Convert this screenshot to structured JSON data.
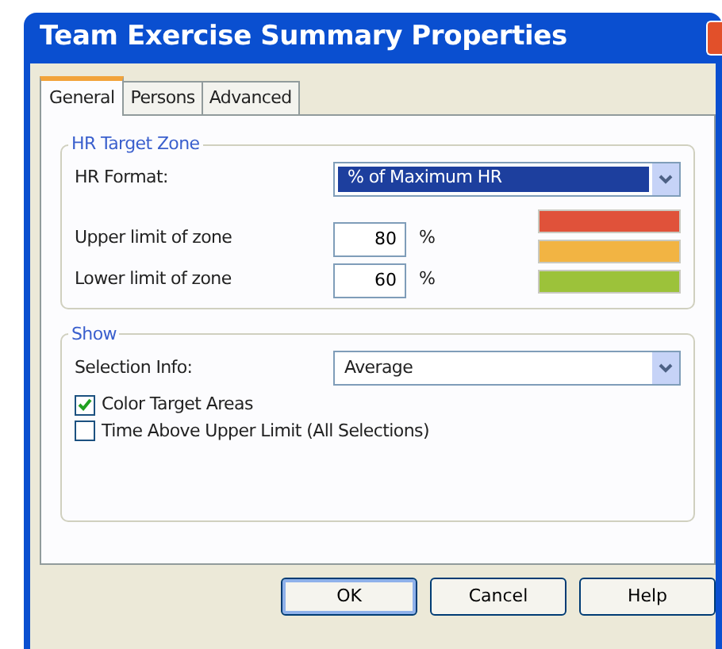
{
  "window": {
    "title": "Team Exercise Summary Properties"
  },
  "tabs": [
    {
      "label": "General",
      "selected": true
    },
    {
      "label": "Persons",
      "selected": false
    },
    {
      "label": "Advanced",
      "selected": false
    }
  ],
  "hr_target_zone": {
    "legend": "HR Target Zone",
    "format_label": "HR Format:",
    "format_value": "% of Maximum HR",
    "limits": [
      {
        "label": "Upper limit of zone",
        "value": "80",
        "unit": "%"
      },
      {
        "label": "Lower limit of zone",
        "value": "60",
        "unit": "%"
      }
    ],
    "zones": [
      {
        "color": "#e0523a"
      },
      {
        "color": "#f2b443"
      },
      {
        "color": "#9cc23a"
      }
    ]
  },
  "show": {
    "legend": "Show",
    "selection_label": "Selection Info:",
    "selection_value": "Average",
    "options": [
      {
        "label": "Color Target Areas",
        "checked": true
      },
      {
        "label": "Time Above Upper Limit (All Selections)",
        "checked": false
      }
    ]
  },
  "buttons": [
    {
      "label": "OK",
      "default": true
    },
    {
      "label": "Cancel",
      "default": false
    },
    {
      "label": "Help",
      "default": false
    }
  ]
}
